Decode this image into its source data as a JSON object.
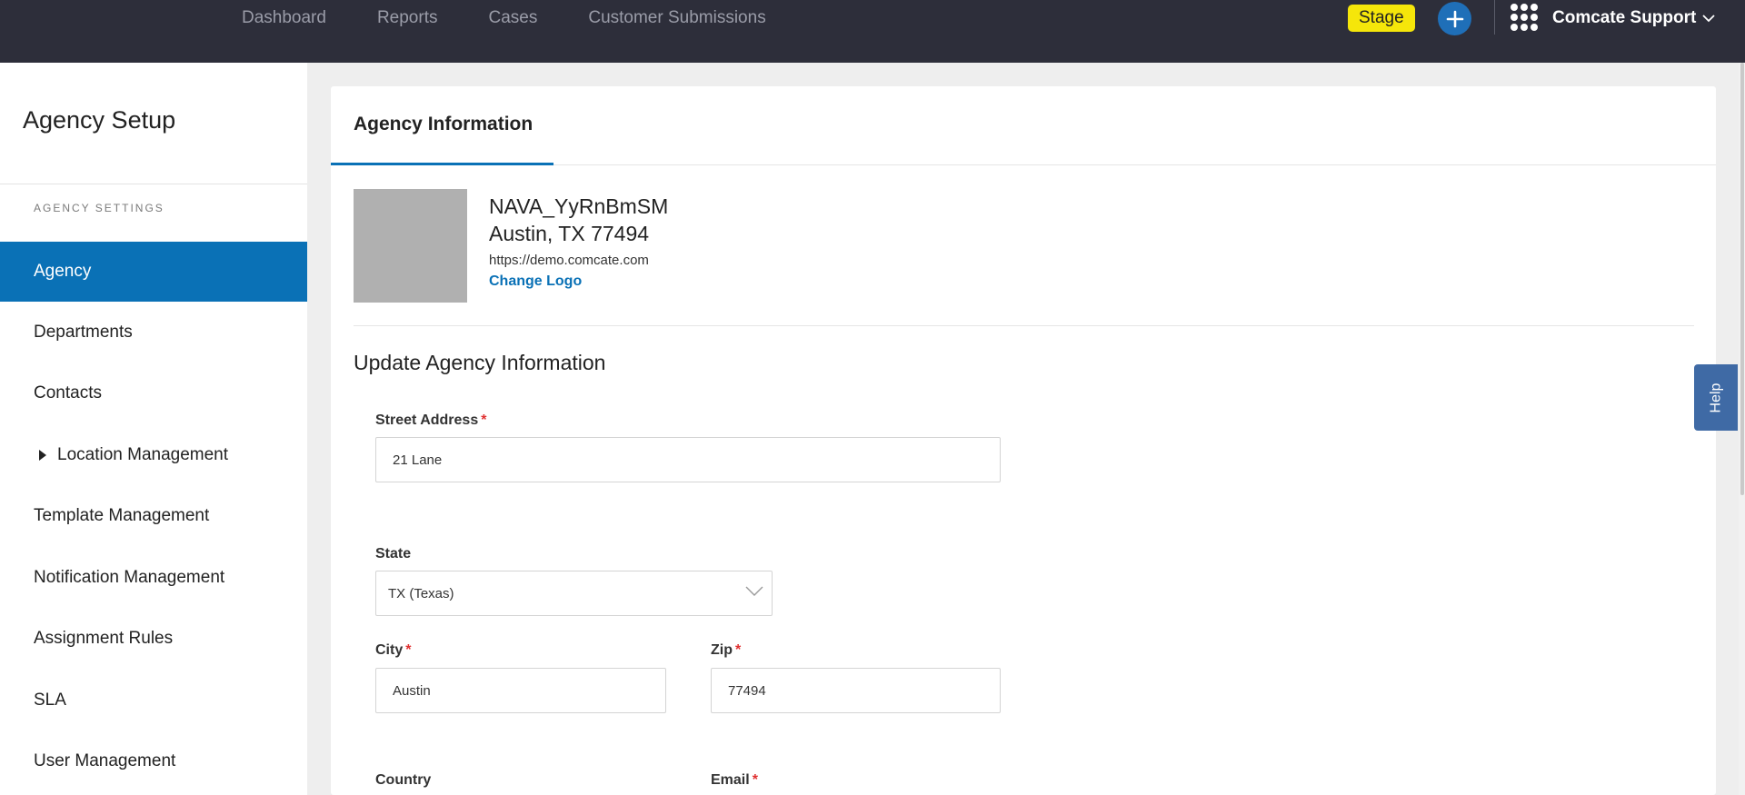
{
  "topnav": {
    "items": [
      "Dashboard",
      "Reports",
      "Cases",
      "Customer Submissions"
    ],
    "stage_label": "Stage",
    "account_name": "Comcate Support"
  },
  "sidebar": {
    "title": "Agency Setup",
    "section_label": "AGENCY SETTINGS",
    "items": [
      {
        "label": "Agency",
        "active": true
      },
      {
        "label": "Departments"
      },
      {
        "label": "Contacts"
      },
      {
        "label": "Location Management",
        "expandable": true
      },
      {
        "label": "Template Management"
      },
      {
        "label": "Notification Management"
      },
      {
        "label": "Assignment Rules"
      },
      {
        "label": "SLA"
      },
      {
        "label": "User Management"
      }
    ]
  },
  "main": {
    "tab_label": "Agency Information",
    "agency": {
      "name": "NAVA_YyRnBmSM",
      "location": "Austin, TX 77494",
      "url": "https://demo.comcate.com",
      "change_logo_label": "Change Logo"
    },
    "form": {
      "title": "Update Agency Information",
      "street": {
        "label": "Street Address",
        "required": "*",
        "value": "21 Lane"
      },
      "state": {
        "label": "State",
        "value": "TX (Texas)"
      },
      "city": {
        "label": "City",
        "required": "*",
        "value": "Austin"
      },
      "zip": {
        "label": "Zip",
        "required": "*",
        "value": "77494"
      },
      "country": {
        "label": "Country"
      },
      "email": {
        "label": "Email",
        "required": "*"
      }
    }
  },
  "help_label": "Help",
  "colors": {
    "topbar": "#2d2e3a",
    "accent": "#0a71b6",
    "stage": "#f5e60a",
    "required": "#e03030"
  }
}
